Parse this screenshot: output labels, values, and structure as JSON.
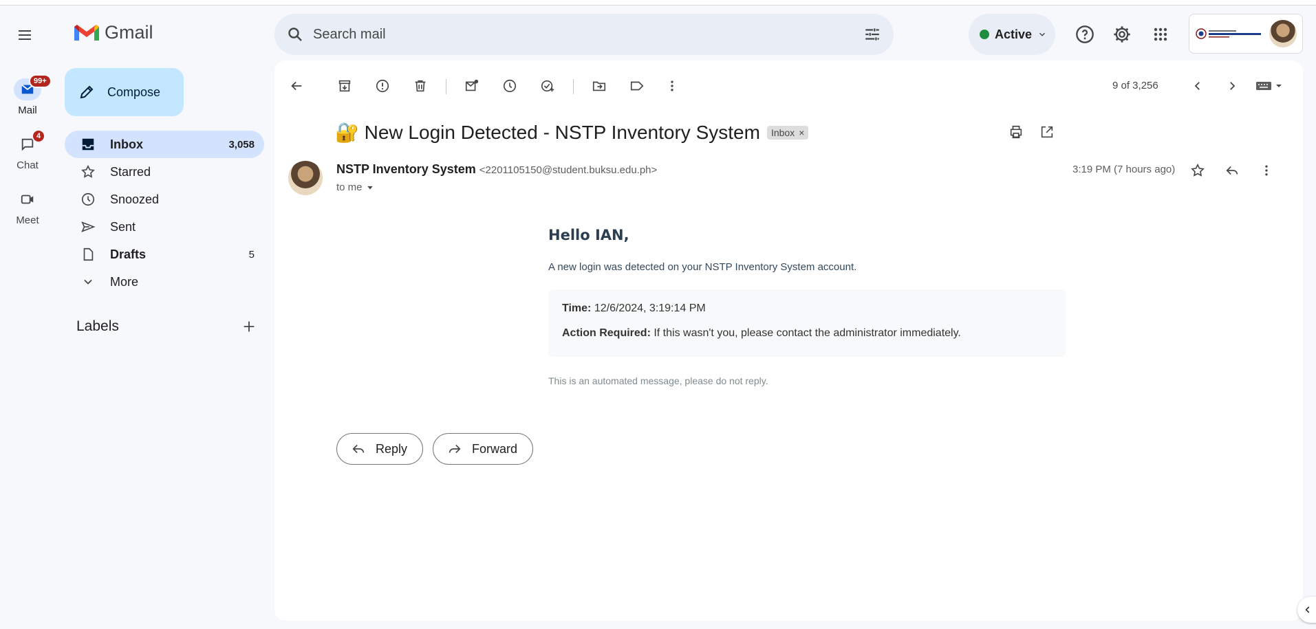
{
  "app": {
    "name": "Gmail"
  },
  "rail": {
    "mail": {
      "label": "Mail",
      "badge": "99+"
    },
    "chat": {
      "label": "Chat",
      "badge": "4"
    },
    "meet": {
      "label": "Meet"
    }
  },
  "search": {
    "placeholder": "Search mail"
  },
  "status": {
    "label": "Active",
    "color": "#1e8e3e"
  },
  "compose": {
    "label": "Compose"
  },
  "nav": {
    "items": [
      {
        "label": "Inbox",
        "count": "3,058",
        "icon": "inbox-icon"
      },
      {
        "label": "Starred",
        "icon": "star-icon"
      },
      {
        "label": "Snoozed",
        "icon": "clock-icon"
      },
      {
        "label": "Sent",
        "icon": "send-icon"
      },
      {
        "label": "Drafts",
        "count": "5",
        "icon": "file-icon"
      },
      {
        "label": "More",
        "icon": "chevron-down-icon"
      }
    ]
  },
  "labels": {
    "title": "Labels"
  },
  "toolbar": {
    "pager": "9 of 3,256"
  },
  "email": {
    "subject": "🔐 New Login Detected - NSTP Inventory System",
    "chip": "Inbox",
    "sender_name": "NSTP Inventory System",
    "sender_email": "<2201105150@student.buksu.edu.ph>",
    "to": "to me",
    "time": "3:19 PM (7 hours ago)",
    "greeting": "Hello IAN,",
    "lead": "A new login was detected on your NSTP Inventory System account.",
    "time_label": "Time:",
    "time_value": "12/6/2024, 3:19:14 PM",
    "action_label": "Action Required:",
    "action_value": "If this wasn't you, please contact the administrator immediately.",
    "footnote": "This is an automated message, please do not reply."
  },
  "actions": {
    "reply": "Reply",
    "forward": "Forward"
  },
  "colors": {
    "accent": "#c2e7ff",
    "nav_active": "#d3e3fd",
    "badge": "#b3261e",
    "panel_bg": "#f6f8fc"
  }
}
